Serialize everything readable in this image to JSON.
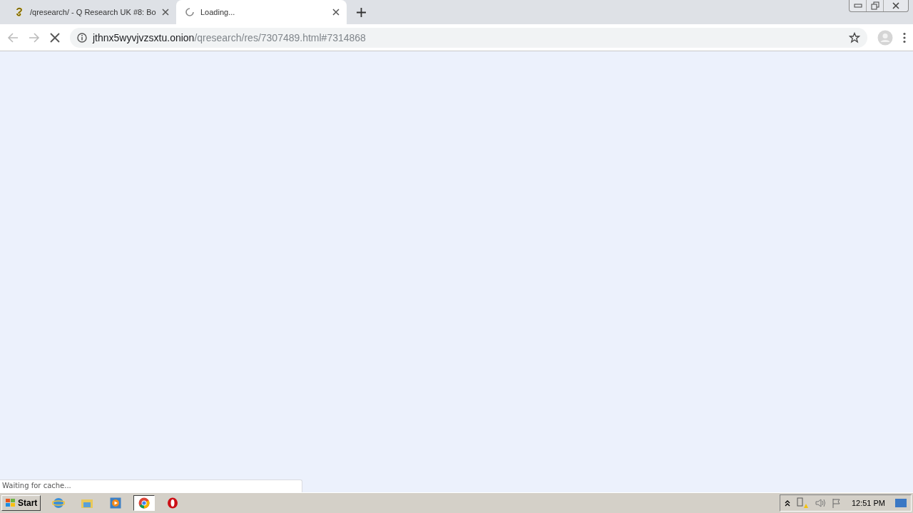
{
  "tabs": [
    {
      "title": "/qresearch/ - Q Research UK #8: Bo",
      "selected": false,
      "loading": false
    },
    {
      "title": "Loading...",
      "selected": true,
      "loading": true
    }
  ],
  "address_bar": {
    "host": "jthnx5wyvjvzsxtu.onion",
    "path": "/qresearch/res/7307489.html#7314868"
  },
  "status_bubble": "Waiting for cache...",
  "taskbar": {
    "start": "Start",
    "clock": "12:51 PM"
  }
}
